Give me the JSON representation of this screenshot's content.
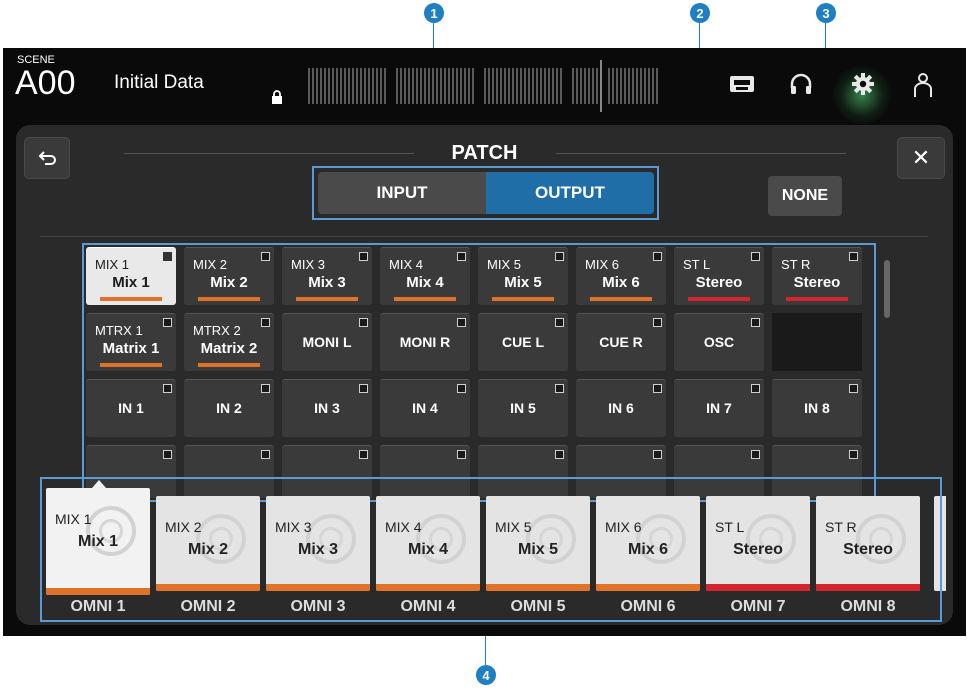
{
  "callouts": [
    "1",
    "2",
    "3",
    "4"
  ],
  "topbar": {
    "scene_tag": "SCENE",
    "scene_number": "A00",
    "scene_name": "Initial Data"
  },
  "icons": {
    "lock": "lock-icon",
    "recorder": "recorder-icon",
    "headphones": "headphones-icon",
    "setup": "gear-icon",
    "user": "user-icon",
    "back": "back-arrow-icon",
    "close": "close-icon"
  },
  "panel": {
    "title": "PATCH",
    "tabs": {
      "input": "INPUT",
      "output": "OUTPUT"
    },
    "active_tab": "OUTPUT",
    "none_label": "NONE",
    "close_label": "✕"
  },
  "colors": {
    "mix": "#e0732a",
    "stereo": "#d2262e",
    "matrix": "#e0732a",
    "active_tab": "#1f6ea8",
    "callout": "#1f7fc2"
  },
  "grid": {
    "row1": [
      {
        "top": "MIX 1",
        "bottom": "Mix 1",
        "bar": "mix"
      },
      {
        "top": "MIX 2",
        "bottom": "Mix 2",
        "bar": "mix"
      },
      {
        "top": "MIX 3",
        "bottom": "Mix 3",
        "bar": "mix"
      },
      {
        "top": "MIX 4",
        "bottom": "Mix 4",
        "bar": "mix"
      },
      {
        "top": "MIX 5",
        "bottom": "Mix 5",
        "bar": "mix"
      },
      {
        "top": "MIX 6",
        "bottom": "Mix 6",
        "bar": "mix"
      },
      {
        "top": "ST L",
        "bottom": "Stereo",
        "bar": "stereo"
      },
      {
        "top": "ST R",
        "bottom": "Stereo",
        "bar": "stereo"
      }
    ],
    "row2": [
      {
        "top": "MTRX 1",
        "bottom": "Matrix 1",
        "bar": "matrix"
      },
      {
        "top": "MTRX 2",
        "bottom": "Matrix 2",
        "bar": "matrix"
      },
      {
        "center": "MONI L"
      },
      {
        "center": "MONI R"
      },
      {
        "center": "CUE L"
      },
      {
        "center": "CUE R"
      },
      {
        "center": "OSC"
      }
    ],
    "row3": [
      "IN 1",
      "IN 2",
      "IN 3",
      "IN 4",
      "IN 5",
      "IN 6",
      "IN 7",
      "IN 8"
    ]
  },
  "omni": [
    {
      "top": "MIX 1",
      "bottom": "Mix 1",
      "label": "OMNI 1",
      "bar": "mix"
    },
    {
      "top": "MIX 2",
      "bottom": "Mix 2",
      "label": "OMNI 2",
      "bar": "mix"
    },
    {
      "top": "MIX 3",
      "bottom": "Mix 3",
      "label": "OMNI 3",
      "bar": "mix"
    },
    {
      "top": "MIX 4",
      "bottom": "Mix 4",
      "label": "OMNI 4",
      "bar": "mix"
    },
    {
      "top": "MIX 5",
      "bottom": "Mix 5",
      "label": "OMNI 5",
      "bar": "mix"
    },
    {
      "top": "MIX 6",
      "bottom": "Mix 6",
      "label": "OMNI 6",
      "bar": "mix"
    },
    {
      "top": "ST L",
      "bottom": "Stereo",
      "label": "OMNI 7",
      "bar": "stereo"
    },
    {
      "top": "ST R",
      "bottom": "Stereo",
      "label": "OMNI 8",
      "bar": "stereo"
    }
  ]
}
